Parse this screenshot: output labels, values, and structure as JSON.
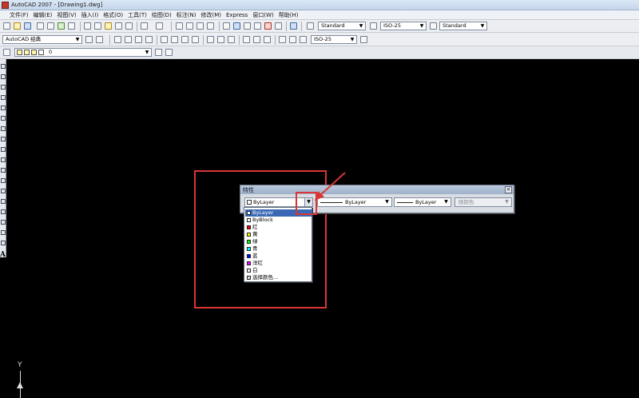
{
  "window": {
    "title": "AutoCAD 2007 - [Drawing1.dwg]"
  },
  "menu": [
    "文件(F)",
    "编辑(E)",
    "视图(V)",
    "插入(I)",
    "格式(O)",
    "工具(T)",
    "绘图(D)",
    "标注(N)",
    "修改(M)",
    "Express",
    "窗口(W)",
    "帮助(H)"
  ],
  "toolbar1": {
    "text_style": "Standard",
    "dim_style": "ISO-25",
    "table_style": "Standard"
  },
  "toolbar2": {
    "workspace": "AutoCAD 经典",
    "dim_style": "ISO-25"
  },
  "toolbar3": {
    "layer": "0"
  },
  "properties_panel": {
    "title": "特性",
    "close_label": "×",
    "color_value": "ByLayer",
    "linetype_value": "ByLayer",
    "lineweight_value": "ByLayer",
    "plotstyle_value": "随颜色"
  },
  "color_dropdown": {
    "items": [
      {
        "label": "ByLayer",
        "color": "#ffffff",
        "selected": true
      },
      {
        "label": "ByBlock",
        "color": "#ffffff",
        "selected": false
      },
      {
        "label": "红",
        "color": "#ff0000",
        "selected": false
      },
      {
        "label": "黄",
        "color": "#ffff00",
        "selected": false
      },
      {
        "label": "绿",
        "color": "#00ff00",
        "selected": false
      },
      {
        "label": "青",
        "color": "#00ffff",
        "selected": false
      },
      {
        "label": "蓝",
        "color": "#0000ff",
        "selected": false
      },
      {
        "label": "洋红",
        "color": "#ff00ff",
        "selected": false
      },
      {
        "label": "白",
        "color": "#ffffff",
        "selected": false
      },
      {
        "label": "选择颜色...",
        "color": "#dddddd",
        "selected": false
      }
    ]
  },
  "annotation_color": "#d93535",
  "ucs_label": "Y"
}
